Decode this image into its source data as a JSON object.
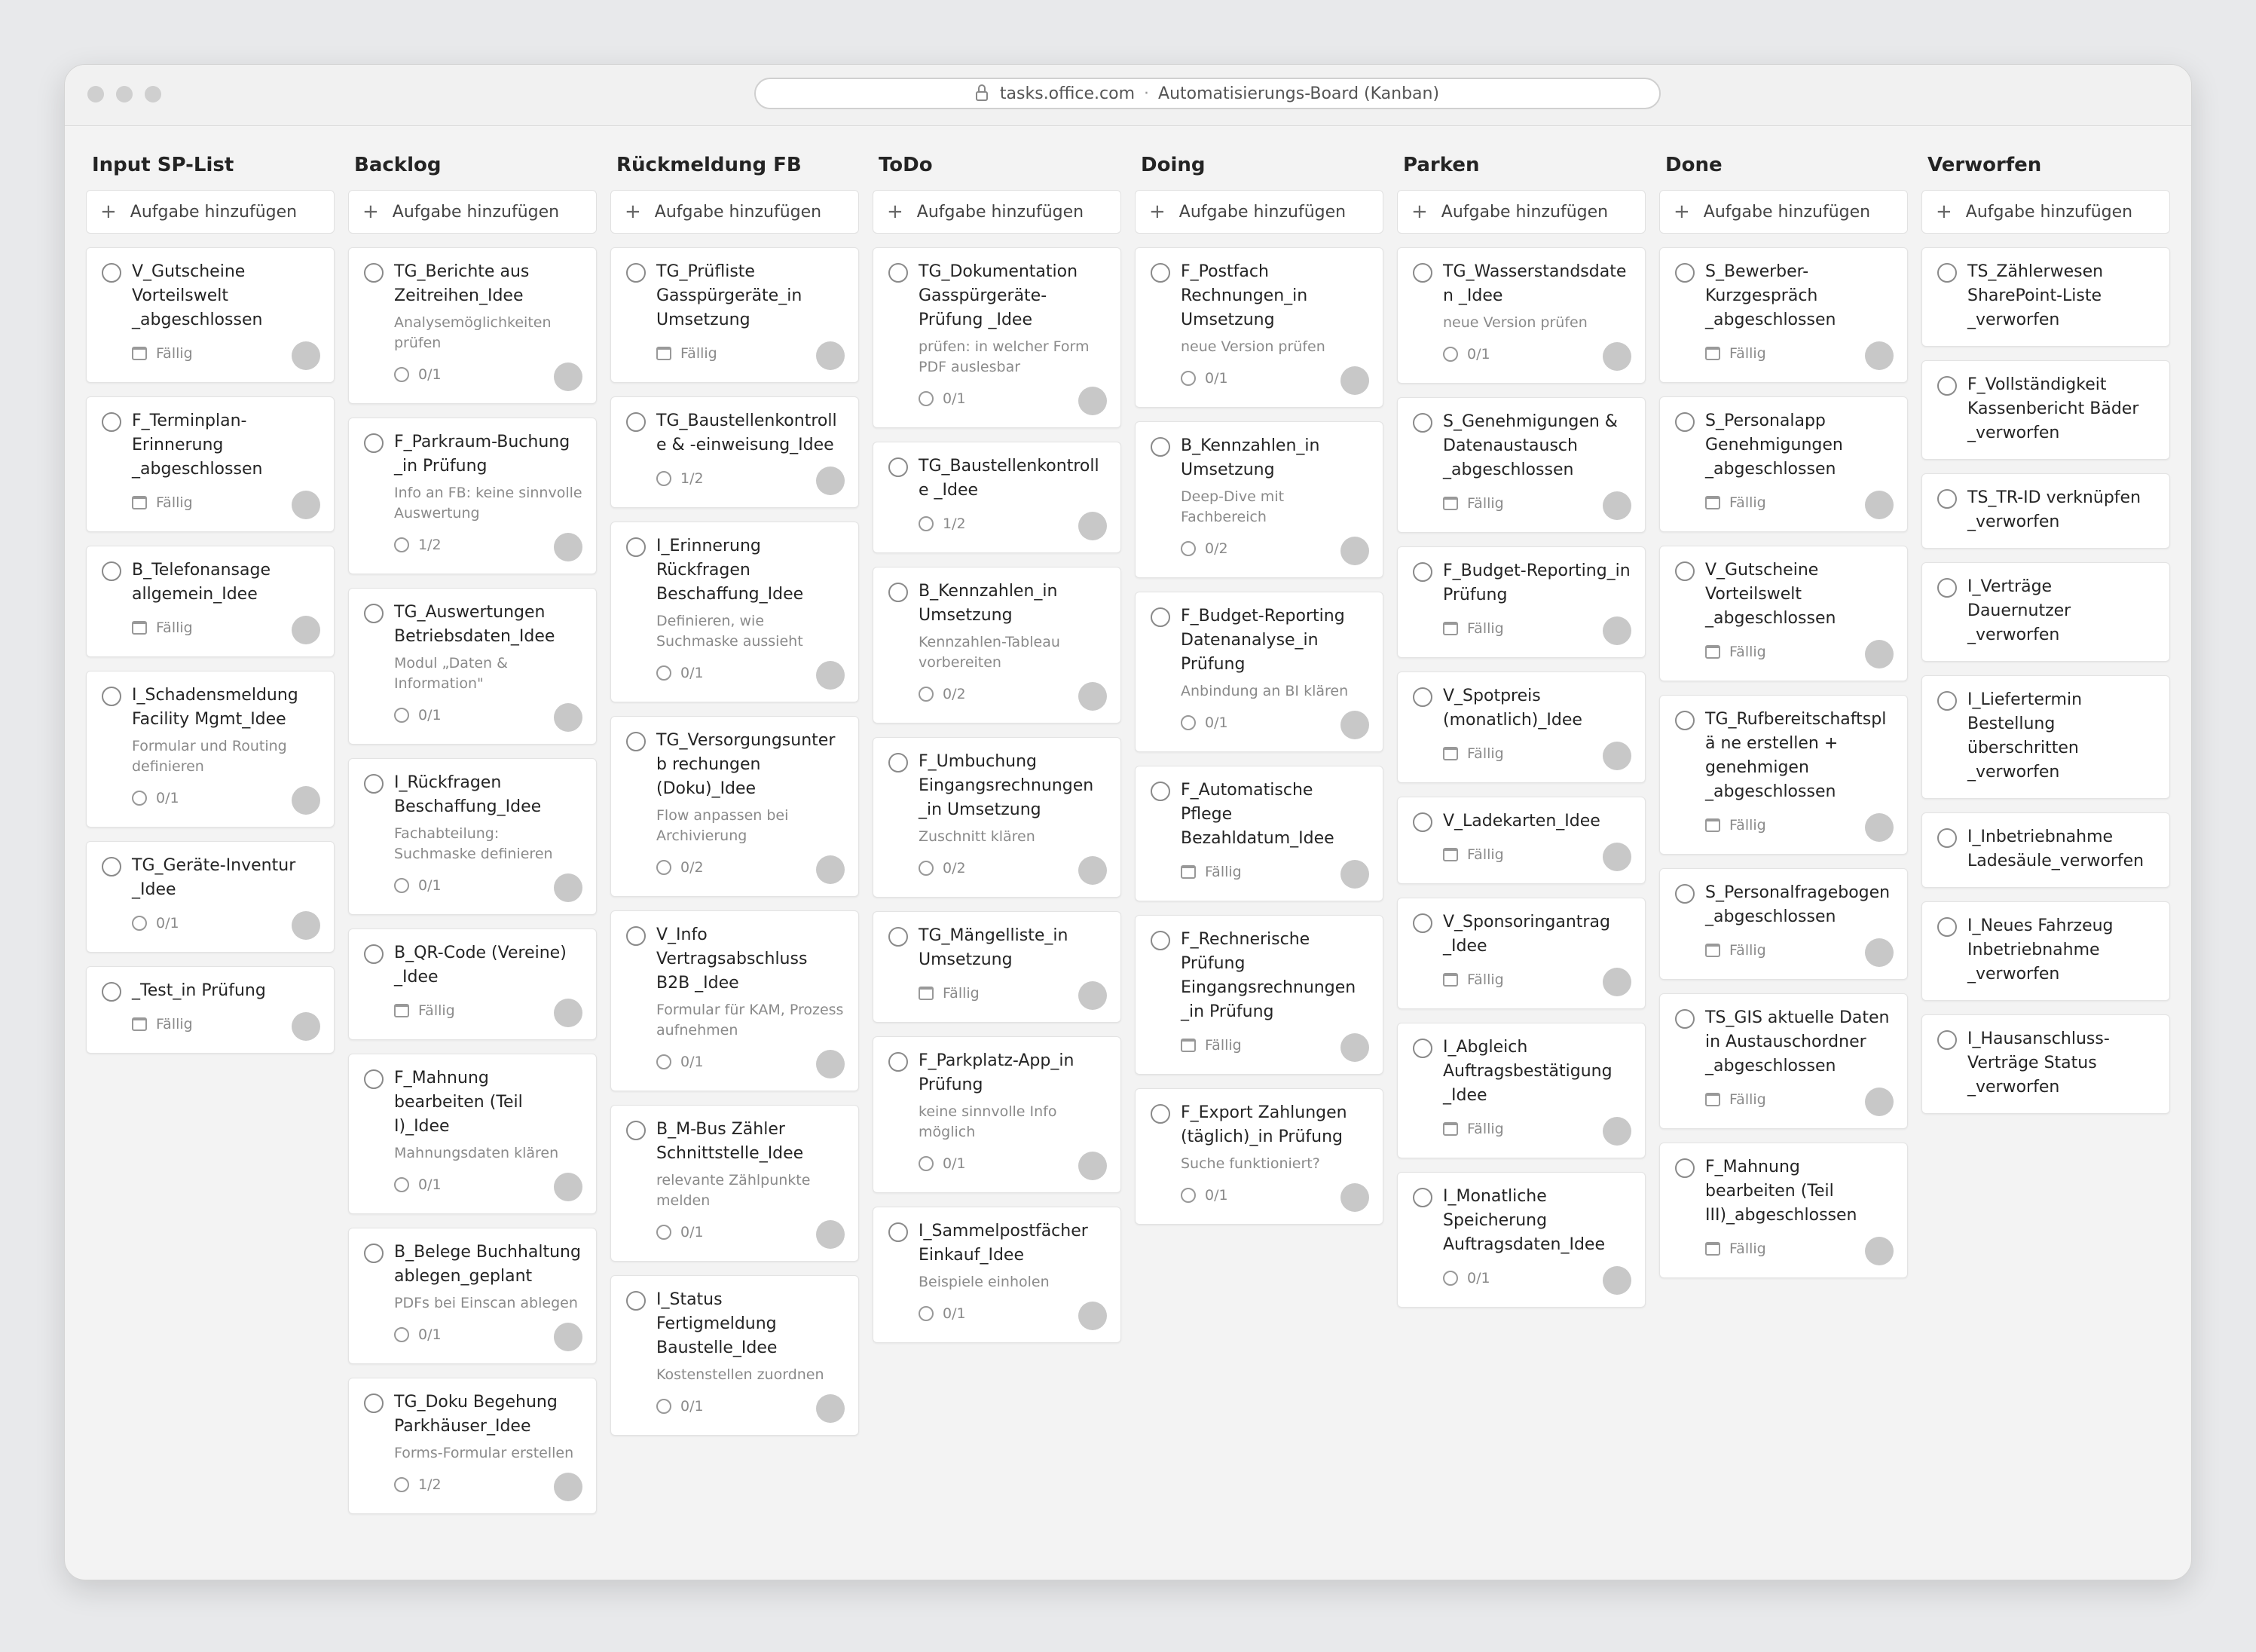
{
  "browser": {
    "url": "tasks.office.com",
    "separator": "·",
    "page_title": "Automatisierungs-Board (Kanban)"
  },
  "board": {
    "add_label": "Aufgabe hinzufügen",
    "columns": [
      {
        "title": "Input SP-List",
        "cards": [
          {
            "title": "V_Gutscheine Vorteilswelt _abgeschlossen",
            "note": "",
            "meta_type": "due",
            "meta": "Fällig"
          },
          {
            "title": "F_Terminplan-Erinnerung _abgeschlossen",
            "note": "",
            "meta_type": "due",
            "meta": "Fällig"
          },
          {
            "title": "B_Telefonansage allgemein_Idee",
            "note": "",
            "meta_type": "due",
            "meta": "Fällig"
          },
          {
            "title": "I_Schadensmeldung Facility Mgmt_Idee",
            "note": "Formular und Routing definieren",
            "meta_type": "progress",
            "meta": "0/1"
          },
          {
            "title": "TG_Geräte-Inventur _Idee",
            "note": "",
            "meta_type": "progress",
            "meta": "0/1"
          },
          {
            "title": "_Test_in Prüfung",
            "note": "",
            "meta_type": "due",
            "meta": "Fällig"
          }
        ]
      },
      {
        "title": "Backlog",
        "cards": [
          {
            "title": "TG_Berichte aus Zeitreihen_Idee",
            "note": "Analysemöglichkeiten prüfen",
            "meta_type": "progress",
            "meta": "0/1"
          },
          {
            "title": "F_Parkraum-Buchung _in Prüfung",
            "note": "Info an FB: keine sinnvolle Auswertung",
            "meta_type": "progress",
            "meta": "1/2"
          },
          {
            "title": "TG_Auswertungen Betriebsdaten_Idee",
            "note": "Modul „Daten & Information\"",
            "meta_type": "progress",
            "meta": "0/1"
          },
          {
            "title": "I_Rückfragen Beschaffung_Idee",
            "note": "Fachabteilung: Suchmaske definieren",
            "meta_type": "progress",
            "meta": "0/1"
          },
          {
            "title": "B_QR-Code (Vereine) _Idee",
            "note": "",
            "meta_type": "due",
            "meta": "Fällig"
          },
          {
            "title": "F_Mahnung bearbeiten (Teil I)_Idee",
            "note": "Mahnungsdaten klären",
            "meta_type": "progress",
            "meta": "0/1"
          },
          {
            "title": "B_Belege Buchhaltung ablegen_geplant",
            "note": "PDFs bei Einscan ablegen",
            "meta_type": "progress",
            "meta": "0/1"
          },
          {
            "title": "TG_Doku Begehung Parkhäuser_Idee",
            "note": "Forms-Formular erstellen",
            "meta_type": "progress",
            "meta": "1/2"
          }
        ]
      },
      {
        "title": "Rückmeldung FB",
        "cards": [
          {
            "title": "TG_Prüfliste Gasspürgeräte_in Umsetzung",
            "note": "",
            "meta_type": "due",
            "meta": "Fällig"
          },
          {
            "title": "TG_Baustellenkontrolle & -einweisung_Idee",
            "note": "",
            "meta_type": "progress",
            "meta": "1/2"
          },
          {
            "title": "I_Erinnerung Rückfragen Beschaffung_Idee",
            "note": "Definieren, wie Suchmaske aussieht",
            "meta_type": "progress",
            "meta": "0/1"
          },
          {
            "title": "TG_Versorgungsunterb rechungen (Doku)_Idee",
            "note": "Flow anpassen bei Archivierung",
            "meta_type": "progress",
            "meta": "0/2"
          },
          {
            "title": "V_Info Vertragsabschluss B2B _Idee",
            "note": "Formular für KAM, Prozess aufnehmen",
            "meta_type": "progress",
            "meta": "0/1"
          },
          {
            "title": "B_M-Bus Zähler Schnittstelle_Idee",
            "note": "relevante Zählpunkte melden",
            "meta_type": "progress",
            "meta": "0/1"
          },
          {
            "title": "I_Status Fertigmeldung Baustelle_Idee",
            "note": "Kostenstellen zuordnen",
            "meta_type": "progress",
            "meta": "0/1"
          }
        ]
      },
      {
        "title": "ToDo",
        "cards": [
          {
            "title": "TG_Dokumentation Gasspürgeräte-Prüfung _Idee",
            "note": "prüfen: in welcher Form PDF auslesbar",
            "meta_type": "progress",
            "meta": "0/1"
          },
          {
            "title": "TG_Baustellenkontrolle _Idee",
            "note": "",
            "meta_type": "progress",
            "meta": "1/2"
          },
          {
            "title": "B_Kennzahlen_in Umsetzung",
            "note": "Kennzahlen-Tableau vorbereiten",
            "meta_type": "progress",
            "meta": "0/2"
          },
          {
            "title": "F_Umbuchung Eingangsrechnungen _in Umsetzung",
            "note": "Zuschnitt klären",
            "meta_type": "progress",
            "meta": "0/2"
          },
          {
            "title": "TG_Mängelliste_in Umsetzung",
            "note": "",
            "meta_type": "due",
            "meta": "Fällig"
          },
          {
            "title": "F_Parkplatz-App_in Prüfung",
            "note": "keine sinnvolle Info möglich",
            "meta_type": "progress",
            "meta": "0/1"
          },
          {
            "title": "I_Sammelpostfächer Einkauf_Idee",
            "note": "Beispiele einholen",
            "meta_type": "progress",
            "meta": "0/1"
          }
        ]
      },
      {
        "title": "Doing",
        "cards": [
          {
            "title": "F_Postfach Rechnungen_in Umsetzung",
            "note": "neue Version prüfen",
            "meta_type": "progress",
            "meta": "0/1"
          },
          {
            "title": "B_Kennzahlen_in Umsetzung",
            "note": "Deep-Dive mit Fachbereich",
            "meta_type": "progress",
            "meta": "0/2"
          },
          {
            "title": "F_Budget-Reporting Datenanalyse_in Prüfung",
            "note": "Anbindung an BI klären",
            "meta_type": "progress",
            "meta": "0/1"
          },
          {
            "title": "F_Automatische Pflege Bezahldatum_Idee",
            "note": "",
            "meta_type": "due",
            "meta": "Fällig"
          },
          {
            "title": "F_Rechnerische Prüfung Eingangsrechnungen _in Prüfung",
            "note": "",
            "meta_type": "due",
            "meta": "Fällig"
          },
          {
            "title": "F_Export Zahlungen (täglich)_in Prüfung",
            "note": "Suche funktioniert?",
            "meta_type": "progress",
            "meta": "0/1"
          }
        ]
      },
      {
        "title": "Parken",
        "cards": [
          {
            "title": "TG_Wasserstandsdaten _Idee",
            "note": "neue Version prüfen",
            "meta_type": "progress",
            "meta": "0/1"
          },
          {
            "title": "S_Genehmigungen & Datenaustausch _abgeschlossen",
            "note": "",
            "meta_type": "due",
            "meta": "Fällig"
          },
          {
            "title": "F_Budget-Reporting_in Prüfung",
            "note": "",
            "meta_type": "due",
            "meta": "Fällig"
          },
          {
            "title": "V_Spotpreis (monatlich)_Idee",
            "note": "",
            "meta_type": "due",
            "meta": "Fällig"
          },
          {
            "title": "V_Ladekarten_Idee",
            "note": "",
            "meta_type": "due",
            "meta": "Fällig"
          },
          {
            "title": "V_Sponsoringantrag _Idee",
            "note": "",
            "meta_type": "due",
            "meta": "Fällig"
          },
          {
            "title": "I_Abgleich Auftragsbestätigung _Idee",
            "note": "",
            "meta_type": "due",
            "meta": "Fällig"
          },
          {
            "title": "I_Monatliche Speicherung Auftragsdaten_Idee",
            "note": "",
            "meta_type": "progress",
            "meta": "0/1"
          }
        ]
      },
      {
        "title": "Done",
        "cards": [
          {
            "title": "S_Bewerber-Kurzgespräch _abgeschlossen",
            "note": "",
            "meta_type": "due",
            "meta": "Fällig"
          },
          {
            "title": "S_Personalapp Genehmigungen _abgeschlossen",
            "note": "",
            "meta_type": "due",
            "meta": "Fällig"
          },
          {
            "title": "V_Gutscheine Vorteilswelt _abgeschlossen",
            "note": "",
            "meta_type": "due",
            "meta": "Fällig"
          },
          {
            "title": "TG_Rufbereitschaftsplä ne erstellen + genehmigen _abgeschlossen",
            "note": "",
            "meta_type": "due",
            "meta": "Fällig"
          },
          {
            "title": "S_Personalfragebogen _abgeschlossen",
            "note": "",
            "meta_type": "due",
            "meta": "Fällig"
          },
          {
            "title": "TS_GIS aktuelle Daten in Austauschordner _abgeschlossen",
            "note": "",
            "meta_type": "due",
            "meta": "Fällig"
          },
          {
            "title": "F_Mahnung bearbeiten (Teil III)_abgeschlossen",
            "note": "",
            "meta_type": "due",
            "meta": "Fällig"
          }
        ]
      },
      {
        "title": "Verworfen",
        "cards": [
          {
            "title": "TS_Zählerwesen SharePoint-Liste _verworfen",
            "note": "",
            "meta_type": "",
            "meta": ""
          },
          {
            "title": "F_Vollständigkeit Kassenbericht Bäder _verworfen",
            "note": "",
            "meta_type": "",
            "meta": ""
          },
          {
            "title": "TS_TR-ID verknüpfen _verworfen",
            "note": "",
            "meta_type": "",
            "meta": ""
          },
          {
            "title": "I_Verträge Dauernutzer _verworfen",
            "note": "",
            "meta_type": "",
            "meta": ""
          },
          {
            "title": "I_Liefertermin Bestellung überschritten _verworfen",
            "note": "",
            "meta_type": "",
            "meta": ""
          },
          {
            "title": "I_Inbetriebnahme Ladesäule_verworfen",
            "note": "",
            "meta_type": "",
            "meta": ""
          },
          {
            "title": "I_Neues Fahrzeug Inbetriebnahme _verworfen",
            "note": "",
            "meta_type": "",
            "meta": ""
          },
          {
            "title": "I_Hausanschluss-Verträge Status _verworfen",
            "note": "",
            "meta_type": "",
            "meta": ""
          }
        ]
      }
    ]
  }
}
